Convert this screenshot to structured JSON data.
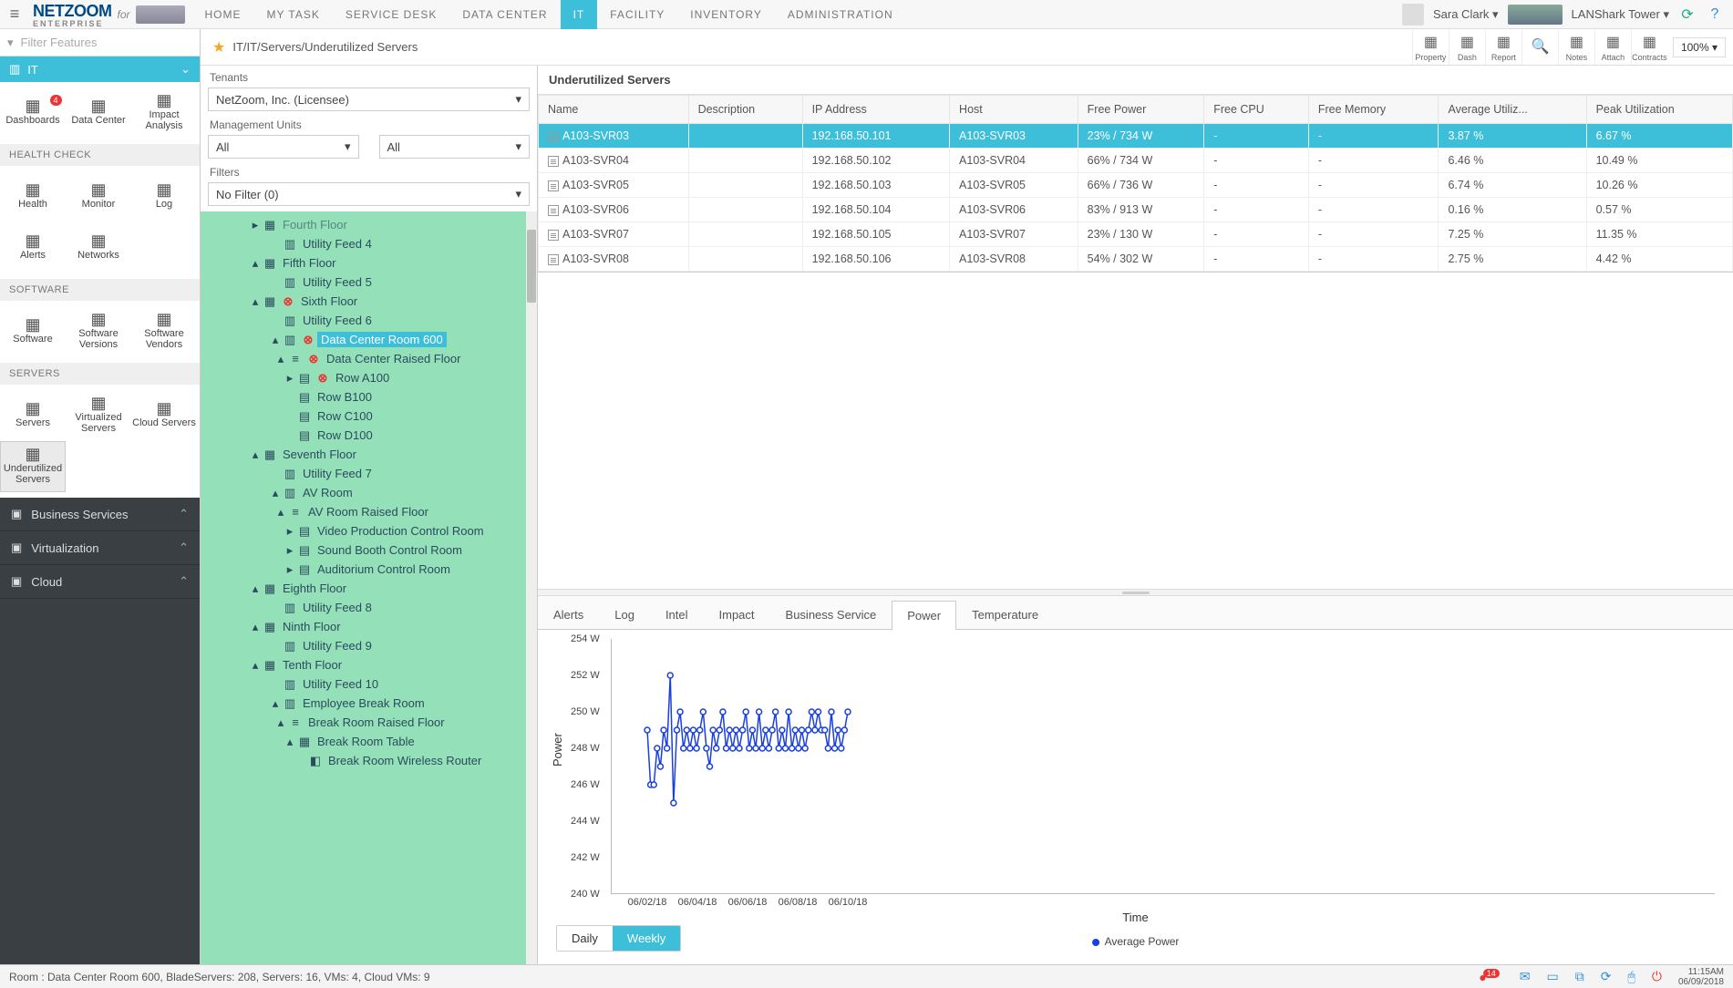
{
  "brand": {
    "name": "NETZOOM",
    "sub": "ENTERPRISE",
    "for": "for"
  },
  "nav": [
    "HOME",
    "MY TASK",
    "SERVICE DESK",
    "DATA CENTER",
    "IT",
    "FACILITY",
    "INVENTORY",
    "ADMINISTRATION"
  ],
  "nav_active": 4,
  "user": {
    "name": "Sara Clark",
    "location": "LANShark Tower"
  },
  "breadcrumb": "IT/IT/Servers/Underutilized Servers",
  "toolbar": [
    {
      "label": "Property",
      "name": "property"
    },
    {
      "label": "Dash",
      "name": "dash"
    },
    {
      "label": "Report",
      "name": "report"
    },
    {
      "label": "",
      "name": "search",
      "icon": "🔍"
    },
    {
      "label": "Notes",
      "name": "notes"
    },
    {
      "label": "Attach",
      "name": "attach"
    },
    {
      "label": "Contracts",
      "name": "contracts"
    }
  ],
  "zoom": "100%",
  "sidebar": {
    "filter_placeholder": "Filter Features",
    "section_title": "IT",
    "top_icons": [
      {
        "label": "Dashboards",
        "badge": "4"
      },
      {
        "label": "Data Center"
      },
      {
        "label": "Impact Analysis"
      }
    ],
    "groups": [
      {
        "title": "HEALTH CHECK",
        "items": [
          {
            "label": "Health"
          },
          {
            "label": "Monitor"
          },
          {
            "label": "Log"
          },
          {
            "label": "Alerts"
          },
          {
            "label": "Networks"
          }
        ]
      },
      {
        "title": "SOFTWARE",
        "items": [
          {
            "label": "Software"
          },
          {
            "label": "Software Versions"
          },
          {
            "label": "Software Vendors"
          }
        ]
      },
      {
        "title": "SERVERS",
        "items": [
          {
            "label": "Servers"
          },
          {
            "label": "Virtualized Servers"
          },
          {
            "label": "Cloud Servers"
          },
          {
            "label": "Underutilized Servers",
            "active": true
          }
        ]
      }
    ],
    "dark": [
      "Business Services",
      "Virtualization",
      "Cloud"
    ]
  },
  "mid": {
    "tenants_label": "Tenants",
    "tenant_value": "NetZoom, Inc. (Licensee)",
    "mu_label": "Management Units",
    "mu_all": "All",
    "filters_label": "Filters",
    "filter_value": "No Filter (0)"
  },
  "tree": [
    {
      "ind": 1,
      "tw": "▸",
      "ico": "▦",
      "label": "Fourth Floor",
      "muted": true
    },
    {
      "ind": 2,
      "tw": "",
      "ico": "▥",
      "label": "Utility Feed 4"
    },
    {
      "ind": 1,
      "tw": "▴",
      "ico": "▦",
      "label": "Fifth Floor"
    },
    {
      "ind": 2,
      "tw": "",
      "ico": "▥",
      "label": "Utility Feed 5"
    },
    {
      "ind": 1,
      "tw": "▴",
      "ico": "▦",
      "err": true,
      "label": "Sixth Floor"
    },
    {
      "ind": 2,
      "tw": "",
      "ico": "▥",
      "label": "Utility Feed 6"
    },
    {
      "ind": 2,
      "tw": "▴",
      "ico": "▥",
      "err": true,
      "label": "Data Center Room 600",
      "hl": true
    },
    {
      "ind": 4,
      "tw": "▴",
      "ico": "≡",
      "err": true,
      "label": "Data Center Raised Floor"
    },
    {
      "ind": 5,
      "tw": "▸",
      "ico": "▤",
      "err": true,
      "label": "Row A100"
    },
    {
      "ind": 5,
      "tw": "",
      "ico": "▤",
      "label": "Row B100"
    },
    {
      "ind": 5,
      "tw": "",
      "ico": "▤",
      "label": "Row C100"
    },
    {
      "ind": 5,
      "tw": "",
      "ico": "▤",
      "label": "Row D100"
    },
    {
      "ind": 1,
      "tw": "▴",
      "ico": "▦",
      "label": "Seventh Floor"
    },
    {
      "ind": 2,
      "tw": "",
      "ico": "▥",
      "label": "Utility Feed 7"
    },
    {
      "ind": 2,
      "tw": "▴",
      "ico": "▥",
      "label": "AV Room"
    },
    {
      "ind": 4,
      "tw": "▴",
      "ico": "≡",
      "label": "AV Room Raised Floor"
    },
    {
      "ind": 5,
      "tw": "▸",
      "ico": "▤",
      "label": "Video Production Control Room"
    },
    {
      "ind": 5,
      "tw": "▸",
      "ico": "▤",
      "label": "Sound Booth Control Room"
    },
    {
      "ind": 5,
      "tw": "▸",
      "ico": "▤",
      "label": "Auditorium Control Room"
    },
    {
      "ind": 1,
      "tw": "▴",
      "ico": "▦",
      "label": "Eighth Floor"
    },
    {
      "ind": 2,
      "tw": "",
      "ico": "▥",
      "label": "Utility Feed 8"
    },
    {
      "ind": 1,
      "tw": "▴",
      "ico": "▦",
      "label": "Ninth Floor"
    },
    {
      "ind": 2,
      "tw": "",
      "ico": "▥",
      "label": "Utility Feed 9"
    },
    {
      "ind": 1,
      "tw": "▴",
      "ico": "▦",
      "label": "Tenth Floor"
    },
    {
      "ind": 2,
      "tw": "",
      "ico": "▥",
      "label": "Utility Feed 10"
    },
    {
      "ind": 2,
      "tw": "▴",
      "ico": "▥",
      "label": "Employee Break Room"
    },
    {
      "ind": 4,
      "tw": "▴",
      "ico": "≡",
      "label": "Break Room Raised Floor"
    },
    {
      "ind": 5,
      "tw": "▴",
      "ico": "▦",
      "label": "Break Room Table"
    },
    {
      "ind": 6,
      "tw": "",
      "ico": "◧",
      "label": "Break Room Wireless Router"
    }
  ],
  "content": {
    "title": "Underutilized Servers",
    "columns": [
      "Name",
      "Description",
      "IP Address",
      "Host",
      "Free Power",
      "Free CPU",
      "Free Memory",
      "Average Utiliz...",
      "Peak Utilization"
    ],
    "rows": [
      {
        "sel": true,
        "cells": [
          "A103-SVR03",
          "",
          "192.168.50.101",
          "A103-SVR03",
          "23% / 734 W",
          "-",
          "-",
          "3.87 %",
          "6.67 %"
        ]
      },
      {
        "cells": [
          "A103-SVR04",
          "",
          "192.168.50.102",
          "A103-SVR04",
          "66% / 734 W",
          "-",
          "-",
          "6.46 %",
          "10.49 %"
        ]
      },
      {
        "cells": [
          "A103-SVR05",
          "",
          "192.168.50.103",
          "A103-SVR05",
          "66% / 736 W",
          "-",
          "-",
          "6.74 %",
          "10.26 %"
        ]
      },
      {
        "cells": [
          "A103-SVR06",
          "",
          "192.168.50.104",
          "A103-SVR06",
          "83% / 913 W",
          "-",
          "-",
          "0.16 %",
          "0.57 %"
        ]
      },
      {
        "cells": [
          "A103-SVR07",
          "",
          "192.168.50.105",
          "A103-SVR07",
          "23% / 130 W",
          "-",
          "-",
          "7.25 %",
          "11.35 %"
        ]
      },
      {
        "cells": [
          "A103-SVR08",
          "",
          "192.168.50.106",
          "A103-SVR08",
          "54% / 302 W",
          "-",
          "-",
          "2.75 %",
          "4.42 %"
        ]
      }
    ]
  },
  "tabs": [
    "Alerts",
    "Log",
    "Intel",
    "Impact",
    "Business Service",
    "Power",
    "Temperature"
  ],
  "tabs_active": 5,
  "range_buttons": [
    "Daily",
    "Weekly"
  ],
  "range_active": 1,
  "chart_data": {
    "type": "line",
    "title": "",
    "xlabel": "Time",
    "ylabel": "Power",
    "ylim": [
      240,
      254
    ],
    "yticks": [
      240,
      242,
      244,
      246,
      248,
      250,
      252,
      254
    ],
    "xticks": [
      "06/02/18",
      "06/04/18",
      "06/06/18",
      "06/08/18",
      "06/10/18"
    ],
    "legend": "Average Power",
    "series": [
      {
        "name": "Average Power",
        "color": "#1a3fe0",
        "values": [
          249,
          246,
          246,
          248,
          247,
          249,
          248,
          252,
          245,
          249,
          250,
          248,
          249,
          248,
          249,
          248,
          249,
          250,
          248,
          247,
          249,
          248,
          249,
          250,
          248,
          249,
          248,
          249,
          248,
          249,
          250,
          248,
          249,
          248,
          250,
          248,
          249,
          248,
          249,
          250,
          248,
          249,
          248,
          250,
          248,
          249,
          248,
          249,
          248,
          249,
          250,
          249,
          250,
          249,
          249,
          248,
          250,
          248,
          249,
          248,
          249,
          250
        ]
      }
    ]
  },
  "status": {
    "text": "Room : Data Center Room 600, BladeServers: 208, Servers: 16, VMs: 4, Cloud VMs: 9",
    "alert_badge": "14",
    "time": "11:15AM",
    "date": "06/09/2018"
  }
}
